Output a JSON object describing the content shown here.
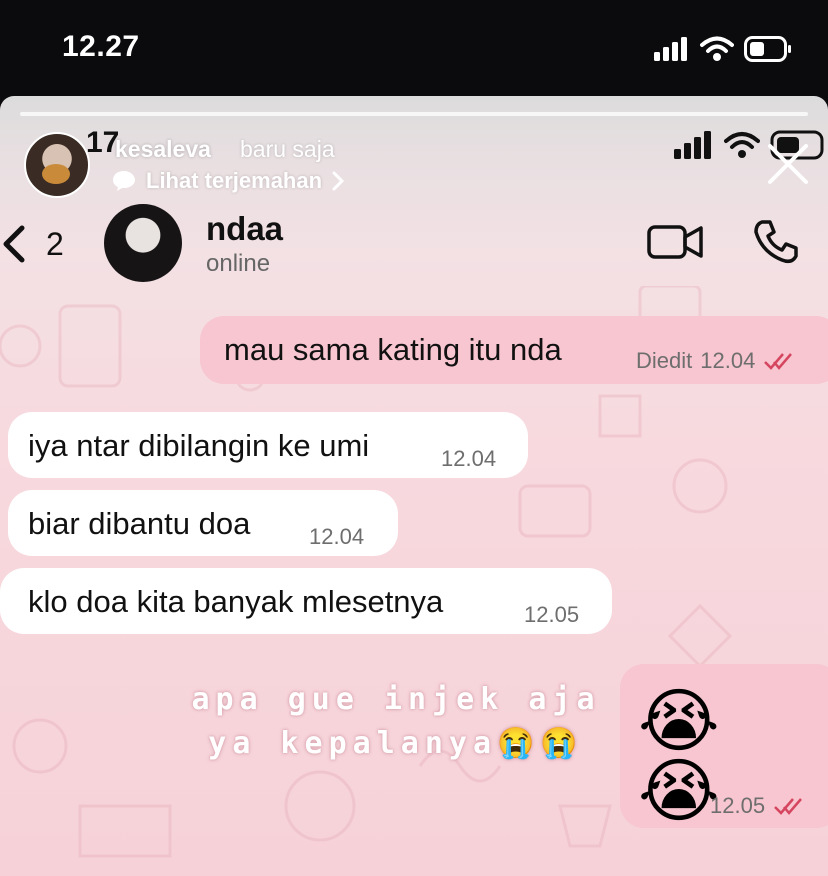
{
  "os_status": {
    "time": "12.27"
  },
  "story": {
    "username": "kesaleva",
    "posted": "baru saja",
    "translate_label": "Lihat terjemahan",
    "embedded_time": "17"
  },
  "chat": {
    "unread_count": "2",
    "contact_name": "ndaa",
    "contact_status": "online",
    "messages": [
      {
        "direction": "out",
        "text": "mau sama kating itu nda",
        "edited_label": "Diedit",
        "time": "12.04"
      },
      {
        "direction": "in",
        "text": "iya ntar dibilangin ke umi",
        "time": "12.04"
      },
      {
        "direction": "in",
        "text": "biar dibantu doa",
        "time": "12.04"
      },
      {
        "direction": "in",
        "text": "klo doa kita banyak mlesetnya",
        "time": "12.05"
      },
      {
        "direction": "out",
        "text": "😭😭",
        "time": "12.05"
      }
    ]
  },
  "overlay_text": "apa gue injek aja\nya kepalanya😭😭",
  "colors": {
    "outgoing_bubble": "#f7c6d0",
    "incoming_bubble": "#ffffff",
    "read_ticks": "#d6455f"
  }
}
